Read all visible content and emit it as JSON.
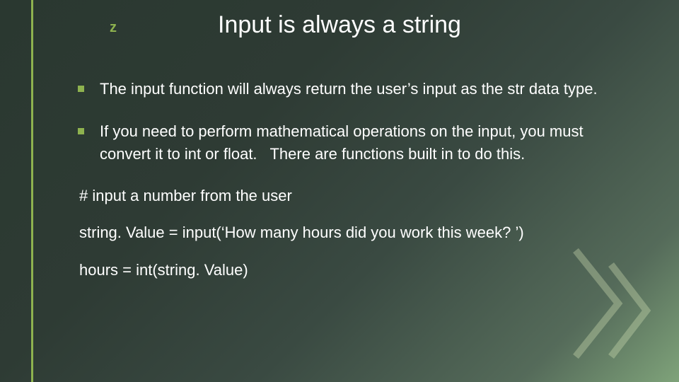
{
  "accent_color": "#8eb24f",
  "logo_glyph": "z",
  "title": "Input is always a string",
  "bullets": [
    "The input function will always return the user’s input as the str data type.",
    "If you need to perform mathematical operations on the input, you must convert it to int or float.   There are functions built in to do this."
  ],
  "code_lines": [
    "# input a number from the user",
    "string. Value = input(‘How many hours did you work this week? ’)",
    "hours = int(string. Value)"
  ]
}
